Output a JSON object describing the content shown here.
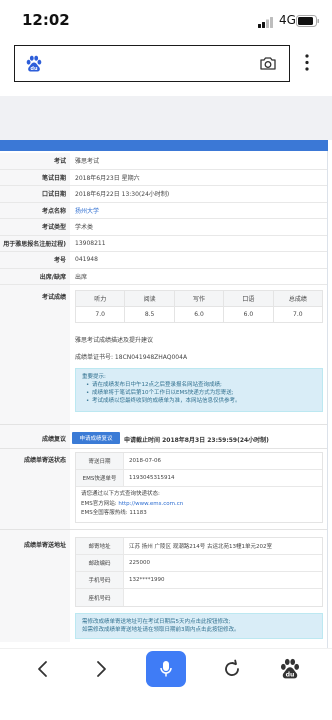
{
  "status_bar": {
    "time": "12:02",
    "network": "4G"
  },
  "browser": {
    "logo_text": "du",
    "nav_logo_text": "du",
    "icons": [
      "baidu-logo",
      "camera",
      "more-vertical"
    ]
  },
  "exam_info": {
    "rows": [
      {
        "label": "考试",
        "value": "雅思考试"
      },
      {
        "label": "笔试日期",
        "value": "2018年6月23日 星期六"
      },
      {
        "label": "口试日期",
        "value": "2018年6月22日 13:30(24小时制)"
      },
      {
        "label": "考点名称",
        "value": "扬州大学"
      },
      {
        "label": "考试类型",
        "value": "学术类"
      },
      {
        "label": "用于雅思报名注册过程)",
        "value": "13908211"
      },
      {
        "label": "考号",
        "value": "041948"
      },
      {
        "label": "出席/缺席",
        "value": "出席"
      }
    ]
  },
  "scores": {
    "label": "考试成绩",
    "headers": [
      "听力",
      "阅读",
      "写作",
      "口语",
      "总成绩"
    ],
    "values": [
      "7.0",
      "8.5",
      "6.0",
      "6.0",
      "7.0"
    ],
    "advice_link": "雅思考试成绩描述及提升建议",
    "certificate": "成绩单证书号: 18CN041948ZHAQ004A"
  },
  "notice": {
    "title": "重要提示:",
    "items": [
      "请在成绩发布日中午12点之后登录报名网站查询成绩;",
      "成绩单将于笔试后第10个工作日以EMS快递方式为您寄送;",
      "考试成绩以您最终收到的成绩单为准，本网站信息仅供参考。"
    ]
  },
  "review": {
    "label": "成绩复议",
    "button": "申请成绩复议",
    "deadline": "申请截止时间 2018年8月3日 23:59:59(24小时制)"
  },
  "delivery_status": {
    "label": "成绩单寄送状态",
    "rows": [
      {
        "label": "寄送日期",
        "value": "2018-07-06"
      },
      {
        "label": "EMS快递单号",
        "value": "1193045315914"
      }
    ],
    "query_intro": "请您通过以下方式查询快递状态:",
    "website_label": "EMS官方网站: ",
    "website_url": "http://www.ems.com.cn",
    "hotline": "EMS全国客服热线: 11183"
  },
  "delivery_address": {
    "label": "成绩单寄送地址",
    "rows": [
      {
        "label": "邮寄地址",
        "value": "江苏 扬州 广陵区 观潮路214号 古运北苑13幢1单元202室"
      },
      {
        "label": "邮政编码",
        "value": "225000"
      },
      {
        "label": "手机号码",
        "value": "132****1990"
      },
      {
        "label": "座机号码",
        "value": ""
      }
    ],
    "notice": [
      "需修改成绩单寄送地址可在考试日期后5天内点击此按钮修改;",
      "如需修改成绩单寄送地址请在领取日期前3周内点击此按钮修改。"
    ]
  },
  "nav": {
    "icons": [
      "back-arrow",
      "forward-arrow",
      "microphone",
      "refresh",
      "baidu-logo"
    ]
  },
  "colors": {
    "header_blue": "#3b78d6",
    "link_blue": "#2a6bd0",
    "notice_bg": "#d9edf7",
    "notice_text": "#31708f",
    "mic_blue": "#3f7cf6",
    "baidu_blue": "#2d5ed9"
  }
}
